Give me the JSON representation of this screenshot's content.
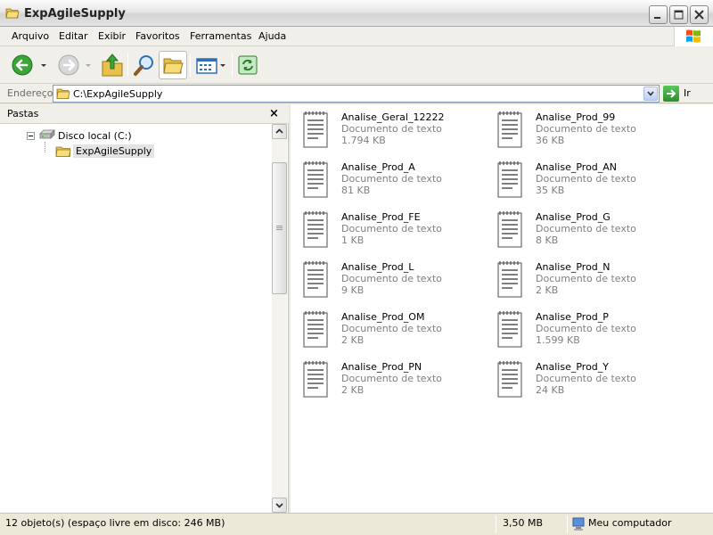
{
  "window": {
    "title": "ExpAgileSupply",
    "icon": "folder-open-icon"
  },
  "menu": {
    "items": [
      "Arquivo",
      "Editar",
      "Exibir",
      "Favoritos",
      "Ferramentas",
      "Ajuda"
    ]
  },
  "toolbar": {
    "buttons": [
      "back-icon",
      "forward-icon",
      "up-folder-icon",
      "search-icon",
      "folders-icon",
      "views-icon",
      "sync-icon"
    ]
  },
  "address": {
    "label": "Endereço",
    "value": "C:\\ExpAgileSupply",
    "go_label": "Ir"
  },
  "folders_pane": {
    "title": "Pastas",
    "close_label": "×",
    "tree": {
      "drive_label": "Disco local (C:)",
      "folder_label": "ExpAgileSupply"
    }
  },
  "files": [
    {
      "name": "Analise_Geral_12222",
      "type": "Documento de texto",
      "size": "1.794 KB"
    },
    {
      "name": "Analise_Prod_99",
      "type": "Documento de texto",
      "size": "36 KB"
    },
    {
      "name": "Analise_Prod_A",
      "type": "Documento de texto",
      "size": "81 KB"
    },
    {
      "name": "Analise_Prod_AN",
      "type": "Documento de texto",
      "size": "35 KB"
    },
    {
      "name": "Analise_Prod_FE",
      "type": "Documento de texto",
      "size": "1 KB"
    },
    {
      "name": "Analise_Prod_G",
      "type": "Documento de texto",
      "size": "8 KB"
    },
    {
      "name": "Analise_Prod_L",
      "type": "Documento de texto",
      "size": "9 KB"
    },
    {
      "name": "Analise_Prod_N",
      "type": "Documento de texto",
      "size": "2 KB"
    },
    {
      "name": "Analise_Prod_OM",
      "type": "Documento de texto",
      "size": "2 KB"
    },
    {
      "name": "Analise_Prod_P",
      "type": "Documento de texto",
      "size": "1.599 KB"
    },
    {
      "name": "Analise_Prod_PN",
      "type": "Documento de texto",
      "size": "2 KB"
    },
    {
      "name": "Analise_Prod_Y",
      "type": "Documento de texto",
      "size": "24 KB"
    }
  ],
  "statusbar": {
    "objects": "12 objeto(s) (espaço livre em disco: 246 MB)",
    "total_size": "3,50 MB",
    "location": "Meu computador"
  }
}
